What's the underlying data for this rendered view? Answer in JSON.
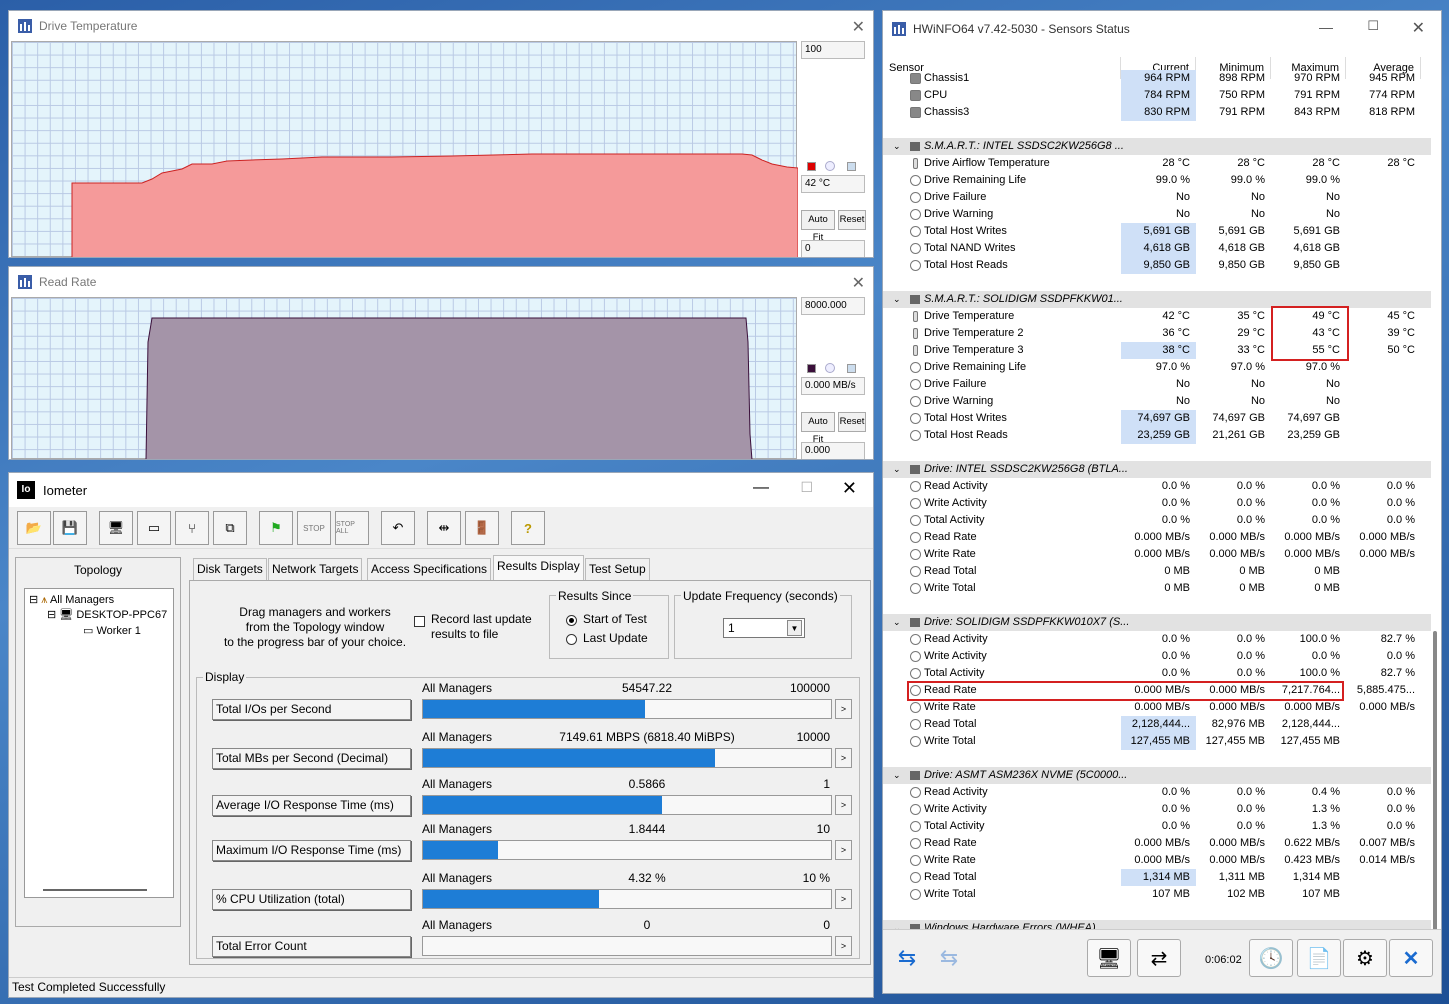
{
  "temp_window": {
    "title": "Drive Temperature",
    "max_label": "100",
    "current_label": "42 °C",
    "min_label": "0",
    "autofit_label": "Auto Fit",
    "reset_label": "Reset"
  },
  "rate_window": {
    "title": "Read Rate",
    "max_label": "8000.000",
    "current_label": "0.000 MB/s",
    "min_label": "0.000",
    "autofit_label": "Auto Fit",
    "reset_label": "Reset"
  },
  "iometer": {
    "title": "Iometer",
    "tabs": [
      "Disk Targets",
      "Network Targets",
      "Access Specifications",
      "Results Display",
      "Test Setup"
    ],
    "topology_label": "Topology",
    "tree": [
      "All Managers",
      "DESKTOP-PPC67",
      "Worker 1"
    ],
    "drag_text": [
      "Drag managers and workers",
      "from the Topology window",
      "to the progress bar of your choice."
    ],
    "record_text": [
      "Record last update",
      "results to file"
    ],
    "results_since": "Results Since",
    "start_of_test": "Start of Test",
    "last_update": "Last Update",
    "update_freq": "Update Frequency (seconds)",
    "update_value": "1",
    "display_label": "Display",
    "status": "Test Completed Successfully",
    "metrics": [
      {
        "label": "Total I/Os per Second",
        "scope": "All Managers",
        "value": "54547.22",
        "max": "100000",
        "fill": 0.5455
      },
      {
        "label": "Total MBs per Second (Decimal)",
        "scope": "All Managers",
        "value": "7149.61 MBPS (6818.40 MiBPS)",
        "max": "10000",
        "fill": 0.715
      },
      {
        "label": "Average I/O Response Time (ms)",
        "scope": "All Managers",
        "value": "0.5866",
        "max": "1",
        "fill": 0.5866
      },
      {
        "label": "Maximum I/O Response Time (ms)",
        "scope": "All Managers",
        "value": "1.8444",
        "max": "10",
        "fill": 0.1844
      },
      {
        "label": "% CPU Utilization (total)",
        "scope": "All Managers",
        "value": "4.32 %",
        "max": "10 %",
        "fill": 0.432
      },
      {
        "label": "Total Error Count",
        "scope": "All Managers",
        "value": "0",
        "max": "0",
        "fill": 0
      }
    ]
  },
  "hwinfo": {
    "title": "HWiNFO64 v7.42-5030 - Sensors Status",
    "headers": [
      "Sensor",
      "Current",
      "Minimum",
      "Maximum",
      "Average"
    ],
    "rows": [
      {
        "t": "s",
        "ic": "fan",
        "name": "Chassis1",
        "cur": "964 RPM",
        "min": "898 RPM",
        "max": "970 RPM",
        "avg": "945 RPM",
        "hl": true
      },
      {
        "t": "s",
        "ic": "fan",
        "name": "CPU",
        "cur": "784 RPM",
        "min": "750 RPM",
        "max": "791 RPM",
        "avg": "774 RPM",
        "hl": true
      },
      {
        "t": "s",
        "ic": "fan",
        "name": "Chassis3",
        "cur": "830 RPM",
        "min": "791 RPM",
        "max": "843 RPM",
        "avg": "818 RPM",
        "hl": true
      },
      {
        "t": "b"
      },
      {
        "t": "g",
        "name": "S.M.A.R.T.: INTEL SSDSC2KW256G8 ..."
      },
      {
        "t": "s",
        "ic": "th",
        "name": "Drive Airflow Temperature",
        "cur": "28 °C",
        "min": "28 °C",
        "max": "28 °C",
        "avg": "28 °C"
      },
      {
        "t": "s",
        "ic": "c",
        "name": "Drive Remaining Life",
        "cur": "99.0 %",
        "min": "99.0 %",
        "max": "99.0 %",
        "avg": ""
      },
      {
        "t": "s",
        "ic": "c",
        "name": "Drive Failure",
        "cur": "No",
        "min": "No",
        "max": "No",
        "avg": ""
      },
      {
        "t": "s",
        "ic": "c",
        "name": "Drive Warning",
        "cur": "No",
        "min": "No",
        "max": "No",
        "avg": ""
      },
      {
        "t": "s",
        "ic": "c",
        "name": "Total Host Writes",
        "cur": "5,691 GB",
        "min": "5,691 GB",
        "max": "5,691 GB",
        "avg": "",
        "hl": true
      },
      {
        "t": "s",
        "ic": "c",
        "name": "Total NAND Writes",
        "cur": "4,618 GB",
        "min": "4,618 GB",
        "max": "4,618 GB",
        "avg": "",
        "hl": true
      },
      {
        "t": "s",
        "ic": "c",
        "name": "Total Host Reads",
        "cur": "9,850 GB",
        "min": "9,850 GB",
        "max": "9,850 GB",
        "avg": "",
        "hl": true
      },
      {
        "t": "b"
      },
      {
        "t": "g",
        "name": "S.M.A.R.T.: SOLIDIGM SSDPFKKW01..."
      },
      {
        "t": "s",
        "ic": "th",
        "name": "Drive Temperature",
        "cur": "42 °C",
        "min": "35 °C",
        "max": "49 °C",
        "avg": "45 °C"
      },
      {
        "t": "s",
        "ic": "th",
        "name": "Drive Temperature 2",
        "cur": "36 °C",
        "min": "29 °C",
        "max": "43 °C",
        "avg": "39 °C"
      },
      {
        "t": "s",
        "ic": "th",
        "name": "Drive Temperature 3",
        "cur": "38 °C",
        "min": "33 °C",
        "max": "55 °C",
        "avg": "50 °C",
        "hl": true
      },
      {
        "t": "s",
        "ic": "c",
        "name": "Drive Remaining Life",
        "cur": "97.0 %",
        "min": "97.0 %",
        "max": "97.0 %",
        "avg": ""
      },
      {
        "t": "s",
        "ic": "c",
        "name": "Drive Failure",
        "cur": "No",
        "min": "No",
        "max": "No",
        "avg": ""
      },
      {
        "t": "s",
        "ic": "c",
        "name": "Drive Warning",
        "cur": "No",
        "min": "No",
        "max": "No",
        "avg": ""
      },
      {
        "t": "s",
        "ic": "c",
        "name": "Total Host Writes",
        "cur": "74,697 GB",
        "min": "74,697 GB",
        "max": "74,697 GB",
        "avg": "",
        "hl": true
      },
      {
        "t": "s",
        "ic": "c",
        "name": "Total Host Reads",
        "cur": "23,259 GB",
        "min": "21,261 GB",
        "max": "23,259 GB",
        "avg": "",
        "hl": true
      },
      {
        "t": "b"
      },
      {
        "t": "g",
        "name": "Drive: INTEL SSDSC2KW256G8 (BTLA..."
      },
      {
        "t": "s",
        "ic": "c",
        "name": "Read Activity",
        "cur": "0.0 %",
        "min": "0.0 %",
        "max": "0.0 %",
        "avg": "0.0 %"
      },
      {
        "t": "s",
        "ic": "c",
        "name": "Write Activity",
        "cur": "0.0 %",
        "min": "0.0 %",
        "max": "0.0 %",
        "avg": "0.0 %"
      },
      {
        "t": "s",
        "ic": "c",
        "name": "Total Activity",
        "cur": "0.0 %",
        "min": "0.0 %",
        "max": "0.0 %",
        "avg": "0.0 %"
      },
      {
        "t": "s",
        "ic": "c",
        "name": "Read Rate",
        "cur": "0.000 MB/s",
        "min": "0.000 MB/s",
        "max": "0.000 MB/s",
        "avg": "0.000 MB/s"
      },
      {
        "t": "s",
        "ic": "c",
        "name": "Write Rate",
        "cur": "0.000 MB/s",
        "min": "0.000 MB/s",
        "max": "0.000 MB/s",
        "avg": "0.000 MB/s"
      },
      {
        "t": "s",
        "ic": "c",
        "name": "Read Total",
        "cur": "0 MB",
        "min": "0 MB",
        "max": "0 MB",
        "avg": ""
      },
      {
        "t": "s",
        "ic": "c",
        "name": "Write Total",
        "cur": "0 MB",
        "min": "0 MB",
        "max": "0 MB",
        "avg": ""
      },
      {
        "t": "b"
      },
      {
        "t": "g",
        "name": "Drive: SOLIDIGM SSDPFKKW010X7 (S..."
      },
      {
        "t": "s",
        "ic": "c",
        "name": "Read Activity",
        "cur": "0.0 %",
        "min": "0.0 %",
        "max": "100.0 %",
        "avg": "82.7 %"
      },
      {
        "t": "s",
        "ic": "c",
        "name": "Write Activity",
        "cur": "0.0 %",
        "min": "0.0 %",
        "max": "0.0 %",
        "avg": "0.0 %"
      },
      {
        "t": "s",
        "ic": "c",
        "name": "Total Activity",
        "cur": "0.0 %",
        "min": "0.0 %",
        "max": "100.0 %",
        "avg": "82.7 %"
      },
      {
        "t": "s",
        "ic": "c",
        "name": "Read Rate",
        "cur": "0.000 MB/s",
        "min": "0.000 MB/s",
        "max": "7,217.764...",
        "avg": "5,885.475..."
      },
      {
        "t": "s",
        "ic": "c",
        "name": "Write Rate",
        "cur": "0.000 MB/s",
        "min": "0.000 MB/s",
        "max": "0.000 MB/s",
        "avg": "0.000 MB/s"
      },
      {
        "t": "s",
        "ic": "c",
        "name": "Read Total",
        "cur": "2,128,444...",
        "min": "82,976 MB",
        "max": "2,128,444...",
        "avg": "",
        "hl": true
      },
      {
        "t": "s",
        "ic": "c",
        "name": "Write Total",
        "cur": "127,455 MB",
        "min": "127,455 MB",
        "max": "127,455 MB",
        "avg": "",
        "hl": true
      },
      {
        "t": "b"
      },
      {
        "t": "g",
        "name": "Drive: ASMT ASM236X NVME (5C0000..."
      },
      {
        "t": "s",
        "ic": "c",
        "name": "Read Activity",
        "cur": "0.0 %",
        "min": "0.0 %",
        "max": "0.4 %",
        "avg": "0.0 %"
      },
      {
        "t": "s",
        "ic": "c",
        "name": "Write Activity",
        "cur": "0.0 %",
        "min": "0.0 %",
        "max": "1.3 %",
        "avg": "0.0 %"
      },
      {
        "t": "s",
        "ic": "c",
        "name": "Total Activity",
        "cur": "0.0 %",
        "min": "0.0 %",
        "max": "1.3 %",
        "avg": "0.0 %"
      },
      {
        "t": "s",
        "ic": "c",
        "name": "Read Rate",
        "cur": "0.000 MB/s",
        "min": "0.000 MB/s",
        "max": "0.622 MB/s",
        "avg": "0.007 MB/s"
      },
      {
        "t": "s",
        "ic": "c",
        "name": "Write Rate",
        "cur": "0.000 MB/s",
        "min": "0.000 MB/s",
        "max": "0.423 MB/s",
        "avg": "0.014 MB/s"
      },
      {
        "t": "s",
        "ic": "c",
        "name": "Read Total",
        "cur": "1,314 MB",
        "min": "1,311 MB",
        "max": "1,314 MB",
        "avg": "",
        "hl": true
      },
      {
        "t": "s",
        "ic": "c",
        "name": "Write Total",
        "cur": "107 MB",
        "min": "102 MB",
        "max": "107 MB",
        "avg": ""
      },
      {
        "t": "b"
      },
      {
        "t": "g",
        "name": "Windows Hardware Errors (WHEA)"
      }
    ],
    "timer": "0:06:02"
  }
}
